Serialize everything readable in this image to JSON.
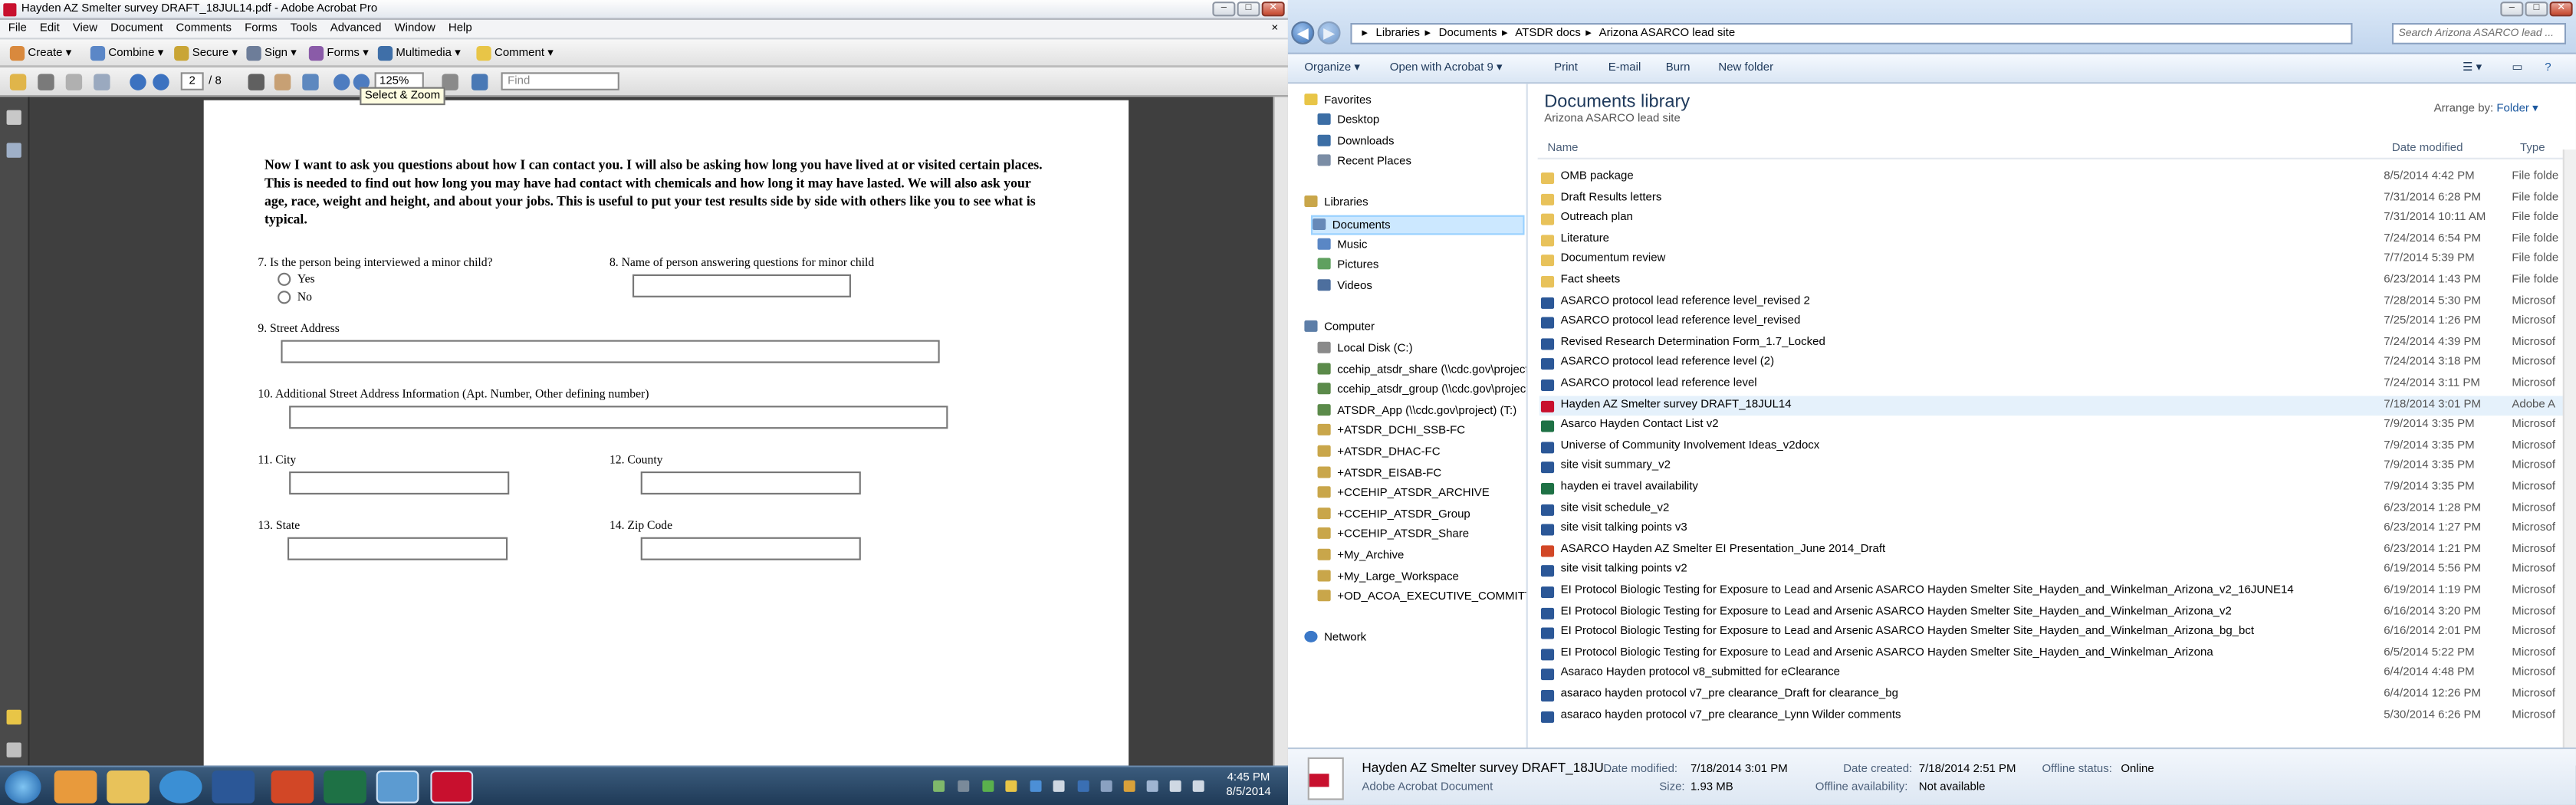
{
  "acrobat": {
    "title": "Hayden AZ Smelter survey DRAFT_18JUL14.pdf - Adobe Acrobat Pro",
    "menu": [
      "File",
      "Edit",
      "View",
      "Document",
      "Comments",
      "Forms",
      "Tools",
      "Advanced",
      "Window",
      "Help"
    ],
    "menu_close": "×",
    "toolbar": {
      "create": "Create",
      "combine": "Combine",
      "secure": "Secure",
      "sign": "Sign",
      "forms": "Forms",
      "multimedia": "Multimedia",
      "comment": "Comment"
    },
    "nav": {
      "page_current": "2",
      "page_total": "/ 8",
      "zoom": "125%",
      "find_placeholder": "Find"
    },
    "tooltip": "Select & Zoom",
    "form": {
      "intro": "Now I want to ask you questions about how I can contact you. I will also be asking how long you have lived at or visited certain places. This is needed to find out how long you may have had contact with chemicals and how long it may have lasted. We will also ask your age, race, weight and height, and about your jobs. This is useful to put your test results side by side with others like you to see what is typical.",
      "q7": "7.   Is the person being interviewed a minor child?",
      "q7_yes": "Yes",
      "q7_no": "No",
      "q8": "8.   Name of person answering questions for minor child",
      "q9": "9.   Street Address",
      "q10": "10.   Additional Street Address Information (Apt. Number, Other defining number)",
      "q11": "11.   City",
      "q12": "12.   County",
      "q13": "13.   State",
      "q14": "14.   Zip Code"
    }
  },
  "explorer": {
    "address": [
      "Libraries",
      "Documents",
      "ATSDR docs",
      "Arizona ASARCO lead site"
    ],
    "search_placeholder": "Search Arizona ASARCO lead ...",
    "commands": {
      "organize": "Organize ▾",
      "open_with": "Open with Acrobat 9 ▾",
      "print": "Print",
      "email": "E-mail",
      "burn": "Burn",
      "new_folder": "New folder"
    },
    "nav": {
      "favorites": "Favorites",
      "desktop": "Desktop",
      "downloads": "Downloads",
      "recent": "Recent Places",
      "libraries": "Libraries",
      "documents": "Documents",
      "music": "Music",
      "pictures": "Pictures",
      "videos": "Videos",
      "computer": "Computer",
      "drives": [
        "Local Disk (C:)",
        "ccehip_atsdr_share (\\\\cdc.gov\\project)",
        "ccehip_atsdr_group (\\\\cdc.gov\\project)",
        "ATSDR_App (\\\\cdc.gov\\project) (T:)",
        "+ATSDR_DCHI_SSB-FC",
        "+ATSDR_DHAC-FC",
        "+ATSDR_EISAB-FC",
        "+CCEHIP_ATSDR_ARCHIVE",
        "+CCEHIP_ATSDR_Group",
        "+CCEHIP_ATSDR_Share",
        "+My_Archive",
        "+My_Large_Workspace",
        "+OD_ACOA_EXECUTIVE_COMMITTEE-"
      ],
      "network": "Network"
    },
    "library_title": "Documents library",
    "library_sub": "Arizona ASARCO lead site",
    "arrange_label": "Arrange by:",
    "arrange_value": "Folder ▾",
    "columns": {
      "name": "Name",
      "date": "Date modified",
      "type": "Type"
    },
    "files": [
      {
        "name": "OMB package",
        "date": "8/5/2014 4:42 PM",
        "type": "File folde",
        "kind": "folder"
      },
      {
        "name": "Draft Results letters",
        "date": "7/31/2014 6:28 PM",
        "type": "File folde",
        "kind": "folder"
      },
      {
        "name": "Outreach plan",
        "date": "7/31/2014 10:11 AM",
        "type": "File folde",
        "kind": "folder"
      },
      {
        "name": "Literature",
        "date": "7/24/2014 6:54 PM",
        "type": "File folde",
        "kind": "folder"
      },
      {
        "name": "Documentum review",
        "date": "7/7/2014 5:39 PM",
        "type": "File folde",
        "kind": "folder"
      },
      {
        "name": "Fact sheets",
        "date": "6/23/2014 1:43 PM",
        "type": "File folde",
        "kind": "folder"
      },
      {
        "name": "ASARCO protocol lead reference level_revised 2",
        "date": "7/28/2014 5:30 PM",
        "type": "Microsof",
        "kind": "word"
      },
      {
        "name": "ASARCO protocol lead reference level_revised",
        "date": "7/25/2014 1:26 PM",
        "type": "Microsof",
        "kind": "word"
      },
      {
        "name": "Revised Research Determination Form_1.7_Locked",
        "date": "7/24/2014 4:39 PM",
        "type": "Microsof",
        "kind": "word"
      },
      {
        "name": "ASARCO protocol lead reference level (2)",
        "date": "7/24/2014 3:18 PM",
        "type": "Microsof",
        "kind": "word"
      },
      {
        "name": "ASARCO protocol lead reference level",
        "date": "7/24/2014 3:11 PM",
        "type": "Microsof",
        "kind": "word"
      },
      {
        "name": "Hayden AZ Smelter survey DRAFT_18JUL14",
        "date": "7/18/2014 3:01 PM",
        "type": "Adobe A",
        "kind": "pdf",
        "selected": true
      },
      {
        "name": "Asarco Hayden Contact List v2",
        "date": "7/9/2014 3:35 PM",
        "type": "Microsof",
        "kind": "excel"
      },
      {
        "name": "Universe of Community Involvement Ideas_v2docx",
        "date": "7/9/2014 3:35 PM",
        "type": "Microsof",
        "kind": "word"
      },
      {
        "name": "site visit summary_v2",
        "date": "7/9/2014 3:35 PM",
        "type": "Microsof",
        "kind": "word"
      },
      {
        "name": "hayden ei travel availability",
        "date": "7/9/2014 3:35 PM",
        "type": "Microsof",
        "kind": "excel"
      },
      {
        "name": "site visit schedule_v2",
        "date": "6/23/2014 1:28 PM",
        "type": "Microsof",
        "kind": "word"
      },
      {
        "name": "site visit talking points v3",
        "date": "6/23/2014 1:27 PM",
        "type": "Microsof",
        "kind": "word"
      },
      {
        "name": "ASARCO Hayden AZ Smelter EI Presentation_June 2014_Draft",
        "date": "6/23/2014 1:21 PM",
        "type": "Microsof",
        "kind": "ppt"
      },
      {
        "name": "site visit talking points v2",
        "date": "6/19/2014 5:56 PM",
        "type": "Microsof",
        "kind": "word"
      },
      {
        "name": "EI Protocol Biologic Testing for Exposure to Lead and Arsenic ASARCO Hayden Smelter Site_Hayden_and_Winkelman_Arizona_v2_16JUNE14",
        "date": "6/19/2014 1:19 PM",
        "type": "Microsof",
        "kind": "word"
      },
      {
        "name": "EI Protocol Biologic Testing for Exposure to Lead and Arsenic ASARCO Hayden Smelter Site_Hayden_and_Winkelman_Arizona_v2",
        "date": "6/16/2014 3:20 PM",
        "type": "Microsof",
        "kind": "word"
      },
      {
        "name": "EI Protocol Biologic Testing for Exposure to Lead and Arsenic ASARCO Hayden Smelter Site_Hayden_and_Winkelman_Arizona_bg_bct",
        "date": "6/16/2014 2:01 PM",
        "type": "Microsof",
        "kind": "word"
      },
      {
        "name": "EI Protocol Biologic Testing for Exposure to Lead and Arsenic ASARCO Hayden Smelter Site_Hayden_and_Winkelman_Arizona",
        "date": "6/5/2014 5:22 PM",
        "type": "Microsof",
        "kind": "word"
      },
      {
        "name": "Asaraco Hayden protocol v8_submitted for eClearance",
        "date": "6/4/2014 4:48 PM",
        "type": "Microsof",
        "kind": "word"
      },
      {
        "name": "asaraco hayden protocol v7_pre clearance_Draft for clearance_bg",
        "date": "6/4/2014 12:26 PM",
        "type": "Microsof",
        "kind": "word"
      },
      {
        "name": "asaraco hayden protocol v7_pre clearance_Lynn Wilder comments",
        "date": "5/30/2014 6:26 PM",
        "type": "Microsof",
        "kind": "word"
      }
    ],
    "details": {
      "name": "Hayden AZ Smelter survey DRAFT_18JU...",
      "type": "Adobe Acrobat Document",
      "date_modified_label": "Date modified:",
      "date_modified": "7/18/2014 3:01 PM",
      "size_label": "Size:",
      "size": "1.93 MB",
      "date_created_label": "Date created:",
      "date_created": "7/18/2014 2:51 PM",
      "offline_avail_label": "Offline availability:",
      "offline_avail": "Not available",
      "offline_status_label": "Offline status:",
      "offline_status": "Online"
    }
  },
  "taskbar": {
    "time": "4:45 PM",
    "date": "8/5/2014"
  },
  "colors": {
    "acrobat_red": "#c8102e",
    "folder": "#e8c25a",
    "word": "#2b5797",
    "excel": "#1e7145",
    "ppt": "#d24726",
    "selection": "#cce8ff"
  }
}
